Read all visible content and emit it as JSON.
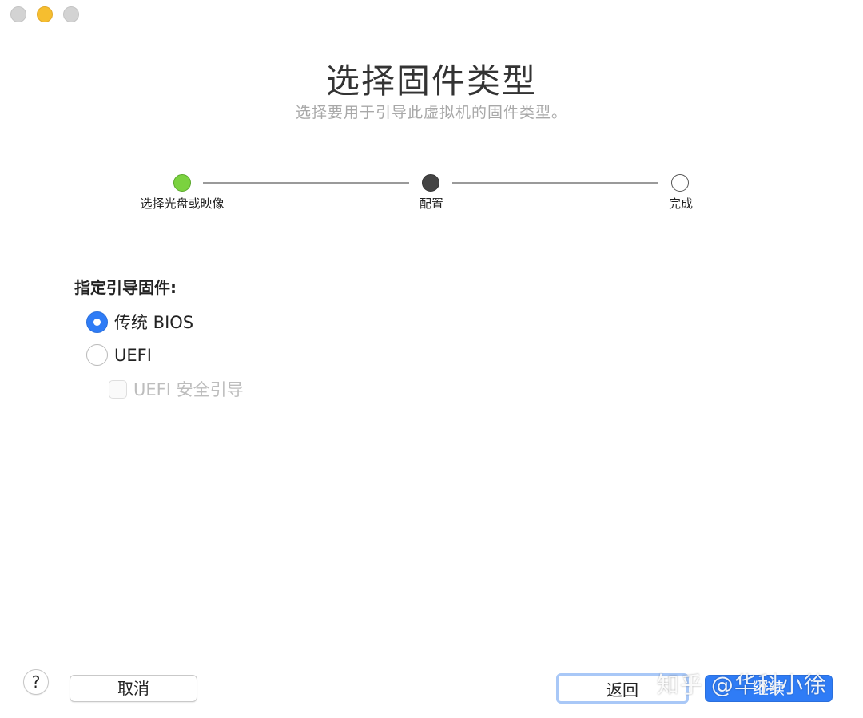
{
  "window": {
    "traffic_lights": [
      "close",
      "minimize",
      "zoom"
    ],
    "title": "选择固件类型",
    "subtitle": "选择要用于引导此虚拟机的固件类型。"
  },
  "stepper": {
    "steps": [
      {
        "label": "选择光盘或映像",
        "state": "done",
        "color": "#7bd23f"
      },
      {
        "label": "配置",
        "state": "current",
        "color": "#444444"
      },
      {
        "label": "完成",
        "state": "todo",
        "color": "#ffffff"
      }
    ]
  },
  "firmware": {
    "label": "指定引导固件:",
    "options": [
      {
        "label": "传统 BIOS",
        "selected": true
      },
      {
        "label": "UEFI",
        "selected": false
      }
    ],
    "secure_boot": {
      "label": "UEFI 安全引导",
      "checked": false,
      "enabled": false
    }
  },
  "footer": {
    "help_label": "?",
    "cancel_label": "取消",
    "back_label": "返回",
    "continue_label": "继续",
    "watermark": "知乎 @华科小徐"
  },
  "colors": {
    "accent": "#2f7cf6",
    "done": "#7bd23f",
    "minimize": "#f6be2f"
  }
}
